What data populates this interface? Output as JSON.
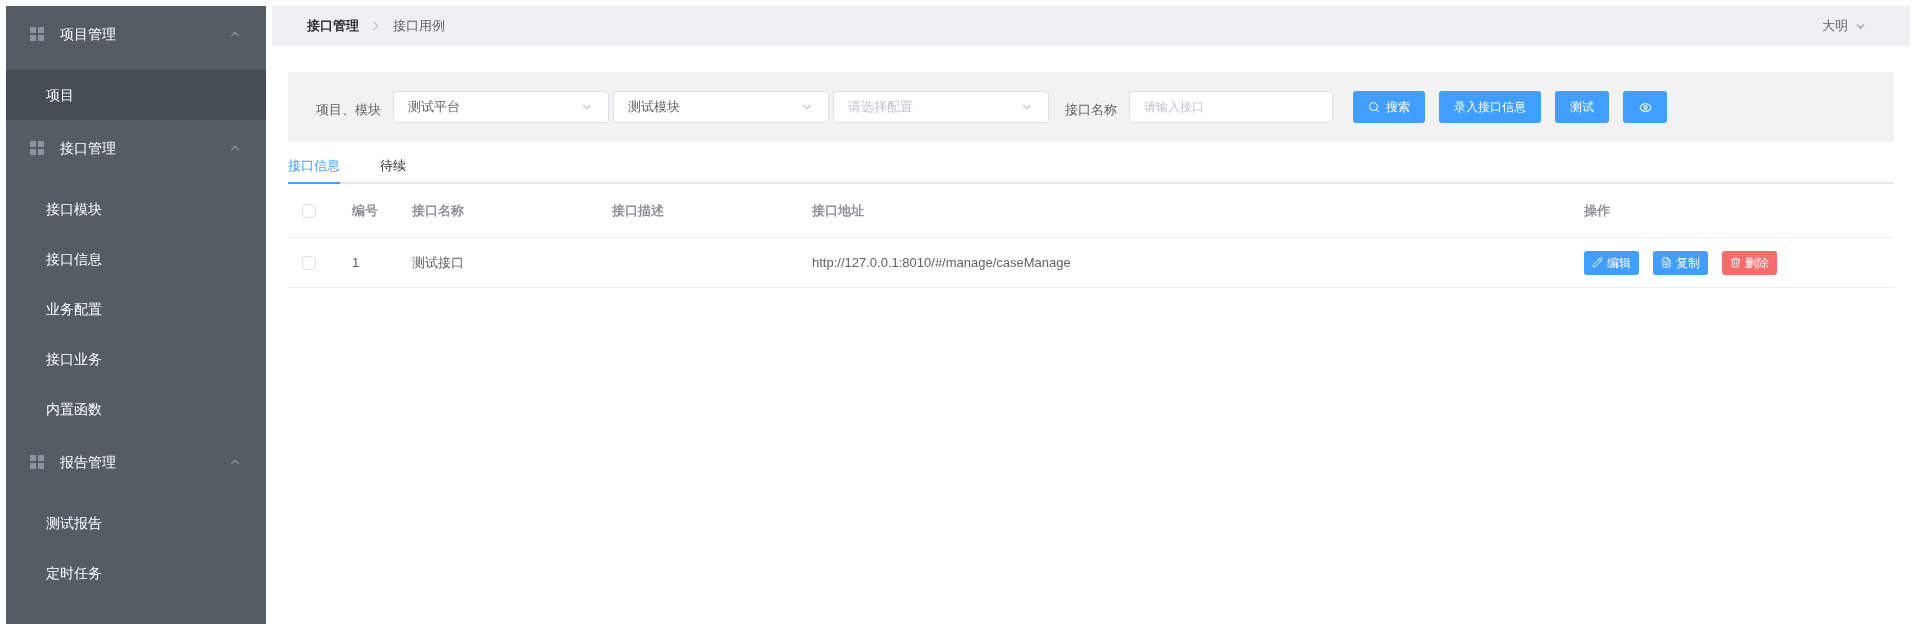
{
  "sidebar": {
    "groups": [
      {
        "label": "项目管理",
        "expanded": true,
        "items": [
          {
            "label": "项目",
            "selected": true
          }
        ]
      },
      {
        "label": "接口管理",
        "expanded": true,
        "items": [
          {
            "label": "接口模块",
            "selected": false
          },
          {
            "label": "接口信息",
            "selected": false
          },
          {
            "label": "业务配置",
            "selected": false
          },
          {
            "label": "接口业务",
            "selected": false
          },
          {
            "label": "内置函数",
            "selected": false
          }
        ]
      },
      {
        "label": "报告管理",
        "expanded": true,
        "items": [
          {
            "label": "测试报告",
            "selected": false
          },
          {
            "label": "定时任务",
            "selected": false
          }
        ]
      }
    ]
  },
  "breadcrumb": [
    "接口管理",
    "接口用例"
  ],
  "user": "大明",
  "filters": {
    "label": "项目、模块",
    "selects": [
      {
        "value": "测试平台"
      },
      {
        "value": "测试模块"
      },
      {
        "placeholder": "请选择配置"
      }
    ],
    "name_label": "接口名称",
    "name_placeholder": "请输入接口",
    "buttons": [
      {
        "kind": "search",
        "label": "搜索"
      },
      {
        "kind": "text",
        "label": "录入接口信息"
      },
      {
        "kind": "text",
        "label": "测试"
      },
      {
        "kind": "eye"
      }
    ]
  },
  "tabs": [
    {
      "label": "接口信息",
      "selected": true
    },
    {
      "label": "待续",
      "selected": false
    }
  ],
  "table": {
    "columns": [
      "编号",
      "接口名称",
      "接口描述",
      "接口地址",
      "操作"
    ],
    "all_checked": false,
    "rows": [
      {
        "checked": false,
        "cells": [
          "1",
          "测试接口",
          "",
          "http://127.0.0.1:8010/#/manage/caseManage"
        ],
        "actions": [
          {
            "kind": "edit",
            "label": "编辑"
          },
          {
            "kind": "copy",
            "label": "复制"
          },
          {
            "kind": "delete",
            "label": "删除"
          }
        ]
      }
    ]
  }
}
